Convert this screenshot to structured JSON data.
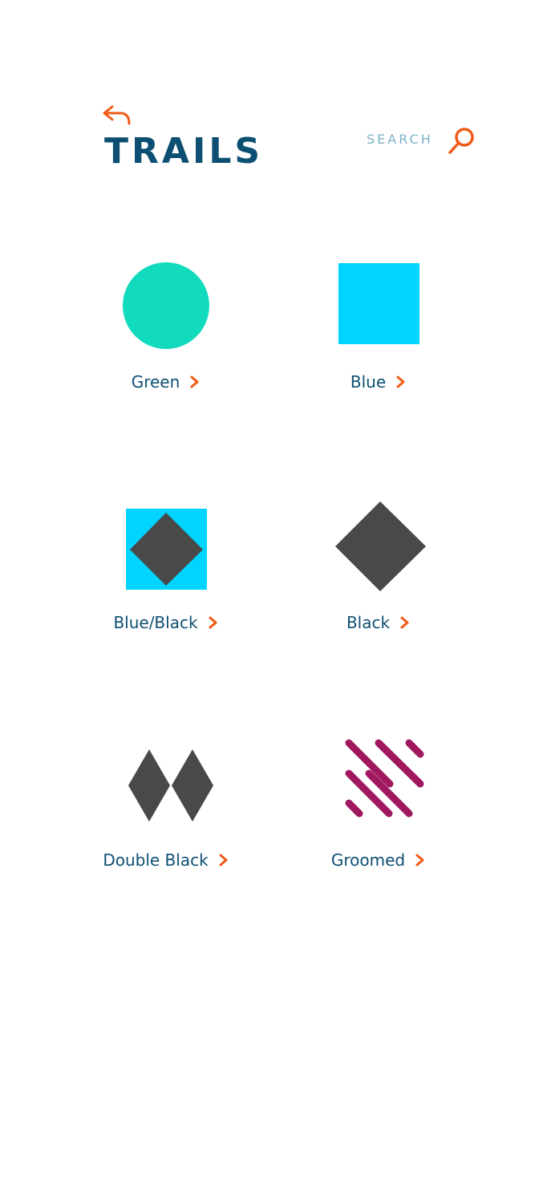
{
  "header": {
    "title": "TRAILS",
    "back_icon": "back-arrow-icon",
    "search_label": "SEARCH",
    "search_icon": "search-icon"
  },
  "colors": {
    "title": "#0d4f72",
    "accent": "#f05a14",
    "search_text": "#7db2c6",
    "green": "#12dbbd",
    "blue": "#00d4ff",
    "black": "#494949",
    "groomed": "#a0185f"
  },
  "trails": [
    {
      "label": "Green",
      "icon": "green-circle-icon"
    },
    {
      "label": "Blue",
      "icon": "blue-square-icon"
    },
    {
      "label": "Blue/Black",
      "icon": "blue-black-square-diamond-icon"
    },
    {
      "label": "Black",
      "icon": "black-diamond-icon"
    },
    {
      "label": "Double Black",
      "icon": "double-black-diamond-icon"
    },
    {
      "label": "Groomed",
      "icon": "groomed-lines-icon"
    }
  ]
}
